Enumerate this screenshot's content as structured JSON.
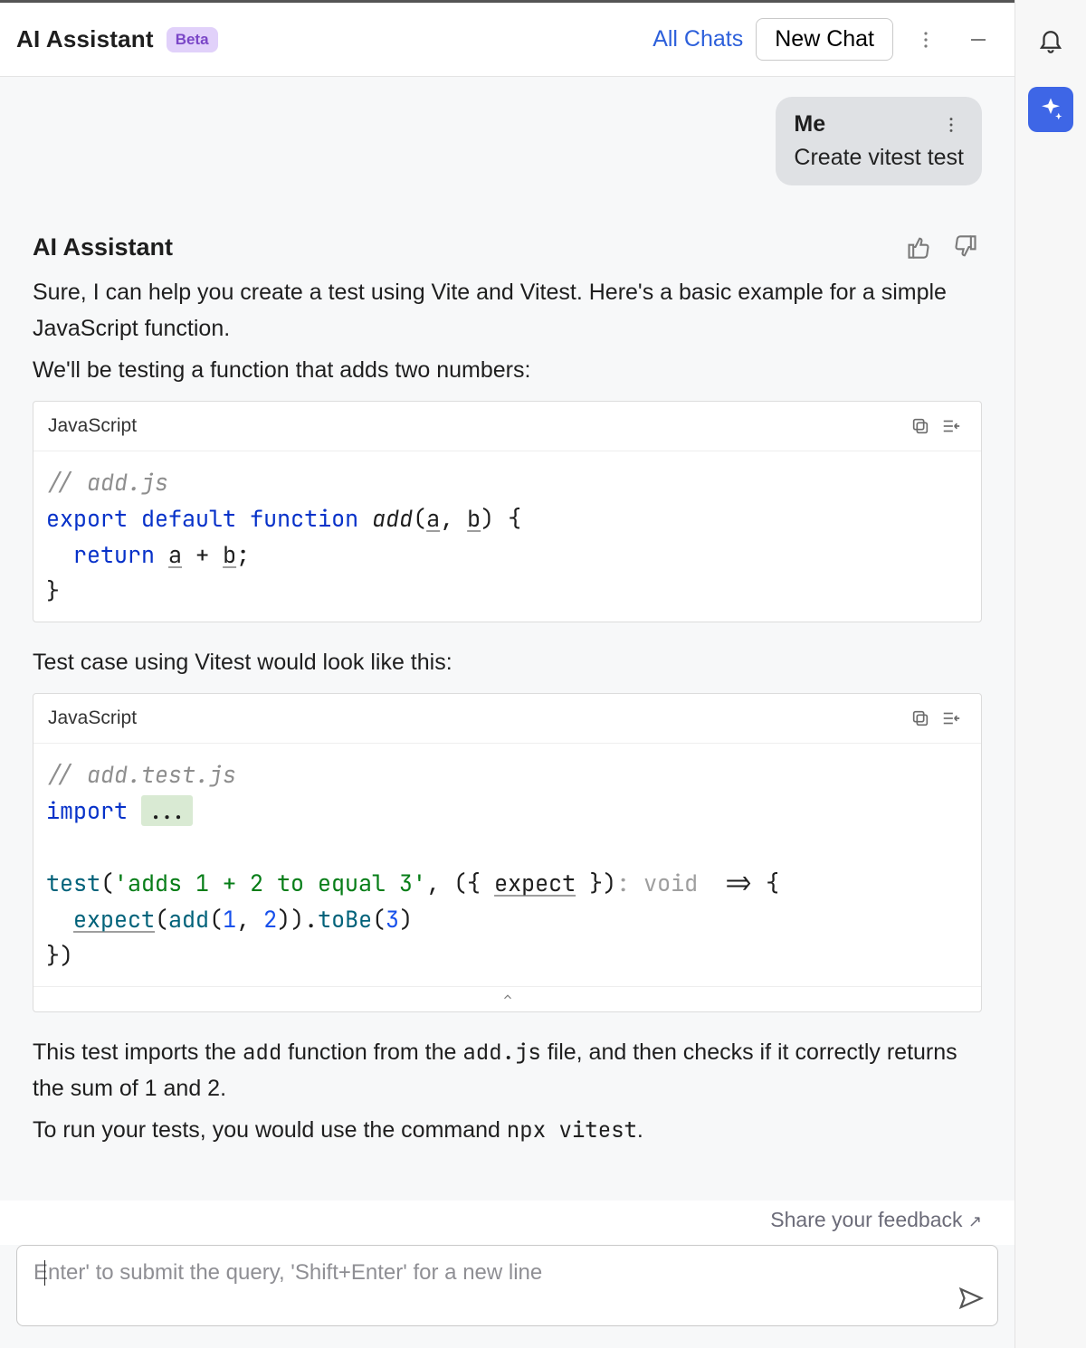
{
  "header": {
    "title": "AI Assistant",
    "badge": "Beta",
    "all_chats": "All Chats",
    "new_chat": "New Chat"
  },
  "user_bubble": {
    "name": "Me",
    "message": "Create vitest test"
  },
  "assistant": {
    "name": "AI Assistant",
    "p1": "Sure, I can help you create a test using Vite and Vitest. Here's a basic example for a simple JavaScript function.",
    "p2": "We'll be testing a function that adds two numbers:",
    "p3": "Test case using Vitest would look like this:",
    "p4a": "This test imports the ",
    "p4b": " function from the ",
    "p4c": " file, and then checks if it correctly returns the sum of 1 and 2.",
    "p5a": "To run your tests, you would use the command ",
    "p5b": ".",
    "inline_add": "add",
    "inline_addjs": "add.js",
    "inline_cmd": "npx vitest"
  },
  "code1": {
    "lang": "JavaScript",
    "c0": "// add.js",
    "kw_export": "export",
    "kw_default": "default",
    "kw_function": "function",
    "fn_name": "add",
    "param_a": "a",
    "param_b": "b",
    "kw_return": "return",
    "ret_a": "a",
    "ret_b": "b"
  },
  "code2": {
    "lang": "JavaScript",
    "c0": "// add.test.js",
    "kw_import": "import",
    "fold": "...",
    "fn_test": "test",
    "str": "'adds 1 + 2 to equal 3'",
    "expect1": "expect",
    "hint": ": void ",
    "fn_expect2": "expect",
    "fn_add": "add",
    "n1": "1",
    "n2": "2",
    "fn_tobe": "toBe",
    "n3": "3"
  },
  "feedback": "Share your feedback",
  "input": {
    "prefix": "|",
    "placeholder": "Enter' to submit the query, 'Shift+Enter' for a new line"
  }
}
